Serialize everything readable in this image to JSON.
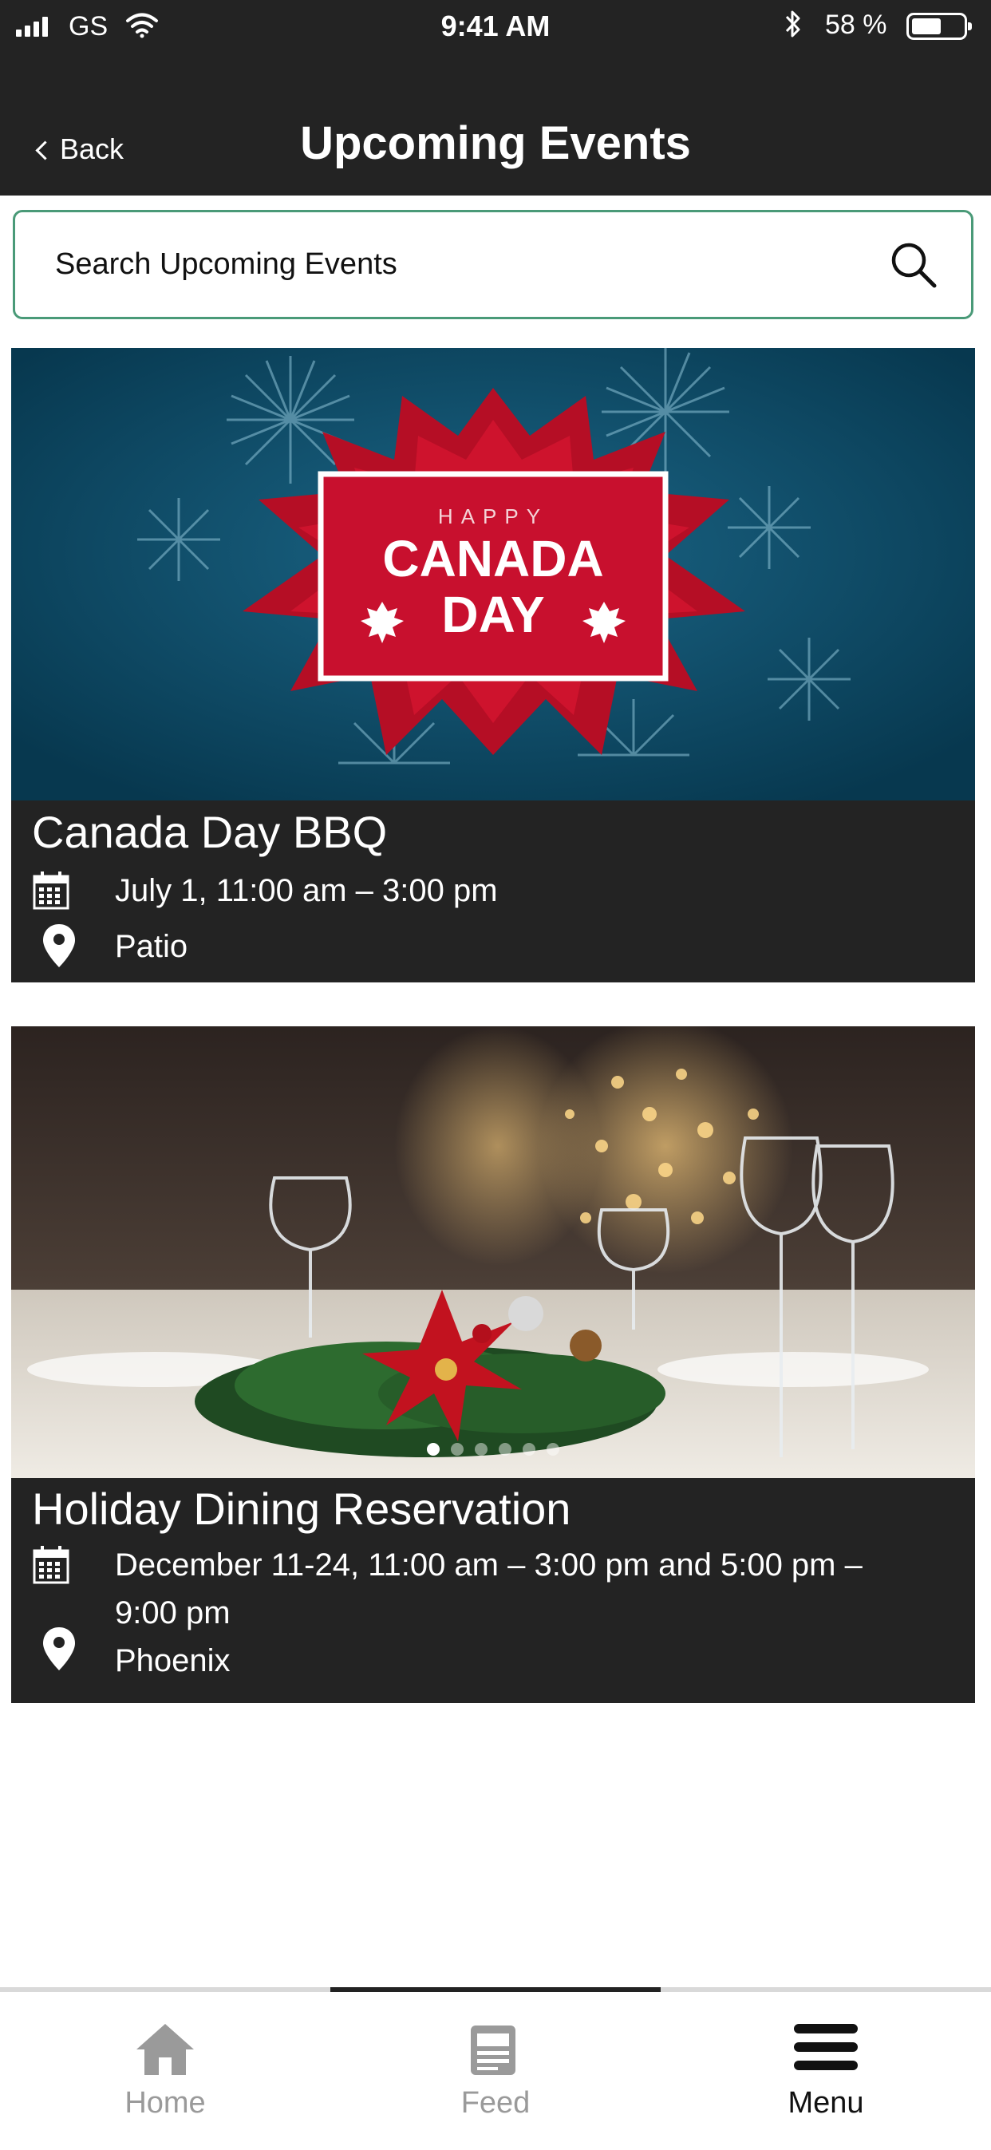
{
  "status_bar": {
    "carrier": "GS",
    "time": "9:41 AM",
    "battery_percent": "58 %",
    "battery_level": 0.58
  },
  "header": {
    "back_label": "Back",
    "title": "Upcoming Events"
  },
  "search": {
    "placeholder": "Search Upcoming Events"
  },
  "events": [
    {
      "banner": {
        "small": "HAPPY",
        "line1": "CANADA",
        "line2": "DAY"
      },
      "title": "Canada Day BBQ",
      "date": "July 1, 11:00 am – 3:00 pm",
      "location": "Patio"
    },
    {
      "title": "Holiday Dining Reservation",
      "date": "December 11-24, 11:00 am – 3:00 pm and 5:00 pm – 9:00 pm",
      "location": "Phoenix",
      "carousel_current": 1
    }
  ],
  "tabbar": {
    "items": [
      {
        "label": "Home",
        "icon": "home-icon"
      },
      {
        "label": "Feed",
        "icon": "document-icon"
      },
      {
        "label": "Menu",
        "icon": "hamburger-menu-icon"
      }
    ],
    "selected": "Menu"
  },
  "colors": {
    "header_bg": "#232323",
    "search_border": "#4a9a78",
    "banner_bg": "#0b4764",
    "canada_red": "#c8102e"
  }
}
